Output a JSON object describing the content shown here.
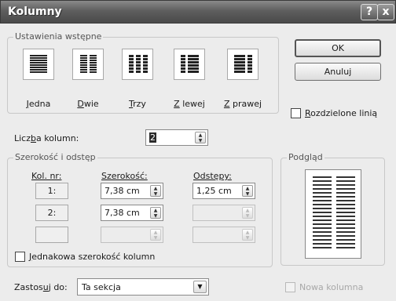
{
  "window": {
    "title": "Kolumny",
    "help_icon": "?",
    "close_icon": "x"
  },
  "presets": {
    "group_label": "Ustawienia wstępne",
    "items": [
      {
        "id": "one",
        "label": "Jedna",
        "mnemonic": "J",
        "rest": "edna",
        "icon": "one-column-icon"
      },
      {
        "id": "two",
        "label": "Dwie",
        "mnemonic": "D",
        "rest": "wie",
        "icon": "two-columns-icon"
      },
      {
        "id": "three",
        "label": "Trzy",
        "mnemonic": "T",
        "rest": "rzy",
        "icon": "three-columns-icon"
      },
      {
        "id": "left",
        "label": "Z lewej",
        "mnemonic": "Z",
        "rest": " lewej",
        "icon": "left-narrow-column-icon"
      },
      {
        "id": "right",
        "label": "Z prawej",
        "mnemonic": "Z",
        "rest": " prawej",
        "icon": "right-narrow-column-icon"
      }
    ]
  },
  "buttons": {
    "ok": "OK",
    "cancel": "Anuluj"
  },
  "line_between": {
    "label": "Rozdzielone linią",
    "mnemonic": "R",
    "rest": "ozdzielone linią",
    "checked": false
  },
  "num_columns": {
    "label_a": "Licz",
    "mnemonic": "b",
    "label_b": "a kolumn:",
    "value": "2"
  },
  "width_spacing": {
    "group_label": "Szerokość i odstęp",
    "col_header": "Kol. nr:",
    "width_header": "Szerokość:",
    "spacing_header": "Odstępy:",
    "rows": [
      {
        "num": "1:",
        "width": "7,38 cm",
        "spacing": "1,25 cm",
        "enabled": true
      },
      {
        "num": "2:",
        "width": "7,38 cm",
        "spacing": "",
        "enabled": true
      },
      {
        "num": "",
        "width": "",
        "spacing": "",
        "enabled": false
      }
    ]
  },
  "equal_width": {
    "mnemonic": "J",
    "rest": "ednakowa szerokość kolumn",
    "checked": false
  },
  "preview": {
    "group_label": "Podgląd"
  },
  "apply_to": {
    "label_a": "Zastos",
    "mnemonic": "u",
    "label_b": "j do:",
    "value": "Ta sekcja"
  },
  "new_column": {
    "label": "Nowa kolumna",
    "checked": false,
    "enabled": false
  }
}
